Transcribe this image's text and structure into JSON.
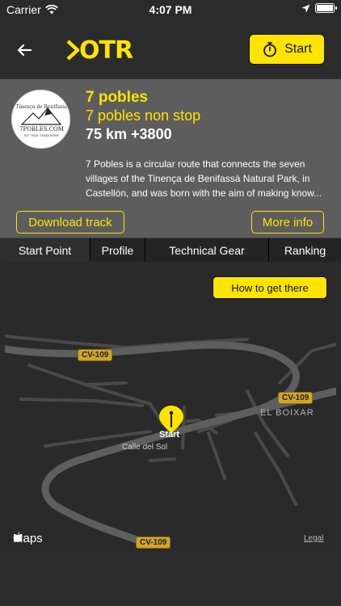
{
  "status_bar": {
    "carrier": "Carrier",
    "time": "4:07 PM"
  },
  "header": {
    "logo": "OTR",
    "start_label": "Start"
  },
  "route": {
    "avatar_lines": [
      "Tinença de Benifassà",
      "7POBLES.COM",
      "BTT·TRAIL·SENDERISME"
    ],
    "title": "7 pobles",
    "subtitle": "7 pobles non stop",
    "stats": "75 km +3800",
    "description": "7 Pobles is a circular route that connects the seven villages of the Tinença de Benifassà Natural Park, in Castellón, and was born with the aim of making know...",
    "download_label": "Download track",
    "more_info_label": "More info"
  },
  "tabs": [
    {
      "label": "Start Point"
    },
    {
      "label": "Profile"
    },
    {
      "label": "Technical Gear"
    },
    {
      "label": "Ranking"
    }
  ],
  "map": {
    "how_to_label": "How to get there",
    "road_labels": [
      "CV-109",
      "CV-109",
      "CV-109"
    ],
    "place": "EL BOIXAR",
    "street": "Calle del Sol",
    "pin_label": "Start",
    "brand": "Maps",
    "legal": "Legal"
  },
  "colors": {
    "accent": "#ffe400",
    "panel": "#5d5d5d",
    "background": "#2b2b2b"
  }
}
